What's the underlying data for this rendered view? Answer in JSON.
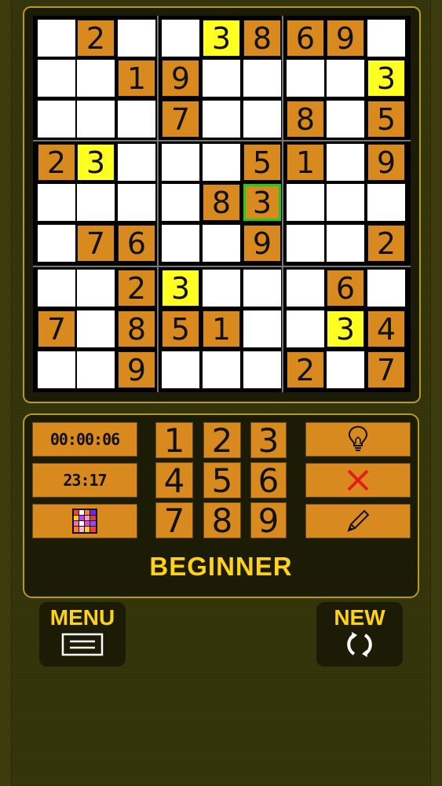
{
  "board": {
    "rows": [
      [
        null,
        "2",
        null,
        null,
        "3",
        "8",
        "6",
        "9",
        null
      ],
      [
        null,
        null,
        "1",
        "9",
        null,
        null,
        null,
        null,
        "3"
      ],
      [
        null,
        null,
        null,
        "7",
        null,
        null,
        "8",
        null,
        "5"
      ],
      [
        "2",
        "3",
        null,
        null,
        null,
        "5",
        "1",
        null,
        "9"
      ],
      [
        null,
        null,
        null,
        null,
        "8",
        "3",
        null,
        null,
        null
      ],
      [
        null,
        "7",
        "6",
        null,
        null,
        "9",
        null,
        null,
        "2"
      ],
      [
        null,
        null,
        "2",
        "3",
        null,
        null,
        null,
        "6",
        null
      ],
      [
        "7",
        null,
        "8",
        "5",
        "1",
        null,
        null,
        "3",
        "4"
      ],
      [
        null,
        null,
        "9",
        null,
        null,
        null,
        "2",
        null,
        "7"
      ]
    ],
    "highlighted_digit": "3",
    "selected_cell": [
      4,
      5
    ]
  },
  "info": {
    "timer": "00:00:06",
    "remaining": "23:17",
    "palette_icon": "color-grid-icon"
  },
  "numpad": [
    "1",
    "2",
    "3",
    "4",
    "5",
    "6",
    "7",
    "8",
    "9"
  ],
  "tools": {
    "hint_icon": "lightbulb-icon",
    "erase_icon": "x-icon",
    "pencil_icon": "pencil-icon"
  },
  "level": "BEGINNER",
  "nav": {
    "menu_label": "MENU",
    "menu_icon": "menu-icon",
    "new_label": "NEW",
    "new_icon": "refresh-icon"
  },
  "colors": {
    "given": "#d88a1f",
    "highlight": "#ffff22",
    "selected_border": "#1fcc1f",
    "accent_text": "#ffd21a",
    "erase": "#e81a1a"
  }
}
